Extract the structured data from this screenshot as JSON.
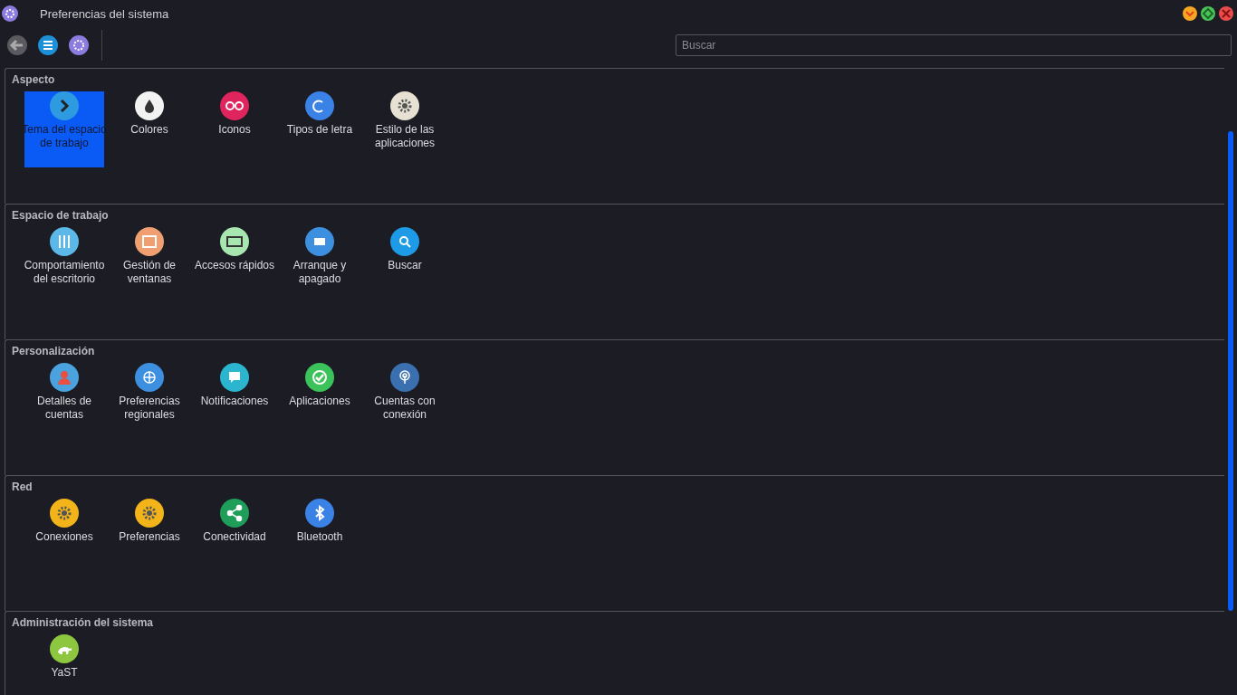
{
  "window": {
    "title": "Preferencias del sistema"
  },
  "search": {
    "placeholder": "Buscar"
  },
  "sections": [
    {
      "title": "Aspecto",
      "items": [
        {
          "label": "Tema del espacio de trabajo",
          "kind": "theme",
          "color": "#2e9ae0",
          "selected": true
        },
        {
          "label": "Colores",
          "kind": "drop",
          "color": "#f2f2f2",
          "selected": false
        },
        {
          "label": "Iconos",
          "kind": "eyes",
          "color": "#e0245e",
          "selected": false
        },
        {
          "label": "Tipos de letra",
          "kind": "font",
          "color": "#3b82e6",
          "selected": false
        },
        {
          "label": "Estilo de las aplicaciones",
          "kind": "gear",
          "color": "#e6e1d3",
          "selected": false
        }
      ]
    },
    {
      "title": "Espacio de trabajo",
      "items": [
        {
          "label": "Comportamiento del escritorio",
          "kind": "sliders",
          "color": "#5bb8e8",
          "selected": false
        },
        {
          "label": "Gestión de ventanas",
          "kind": "window",
          "color": "#f0a070",
          "selected": false
        },
        {
          "label": "Accesos rápidos",
          "kind": "keyboard",
          "color": "#a8e6b0",
          "selected": false
        },
        {
          "label": "Arranque y apagado",
          "kind": "screen",
          "color": "#3d8fe0",
          "selected": false
        },
        {
          "label": "Buscar",
          "kind": "search",
          "color": "#1e9be6",
          "selected": false
        }
      ]
    },
    {
      "title": "Personalización",
      "items": [
        {
          "label": "Detalles de cuentas",
          "kind": "person",
          "color": "#4aa3df",
          "selected": false
        },
        {
          "label": "Preferencias regionales",
          "kind": "globe",
          "color": "#3d8fe0",
          "selected": false
        },
        {
          "label": "Notificaciones",
          "kind": "bubble",
          "color": "#2bb5cf",
          "selected": false
        },
        {
          "label": "Aplicaciones",
          "kind": "check",
          "color": "#3cc25a",
          "selected": false
        },
        {
          "label": "Cuentas con conexión",
          "kind": "touch",
          "color": "#3a6fb0",
          "selected": false
        }
      ]
    },
    {
      "title": "Red",
      "items": [
        {
          "label": "Conexiones",
          "kind": "gear",
          "color": "#f2b418",
          "selected": false
        },
        {
          "label": "Preferencias",
          "kind": "gear",
          "color": "#f2b418",
          "selected": false
        },
        {
          "label": "Conectividad",
          "kind": "share",
          "color": "#1e9e58",
          "selected": false
        },
        {
          "label": "Bluetooth",
          "kind": "bluetooth",
          "color": "#3b82e6",
          "selected": false
        }
      ]
    },
    {
      "title": "Administración del sistema",
      "items": [
        {
          "label": "YaST",
          "kind": "chameleon",
          "color": "#8dc63f",
          "selected": false
        }
      ]
    }
  ]
}
